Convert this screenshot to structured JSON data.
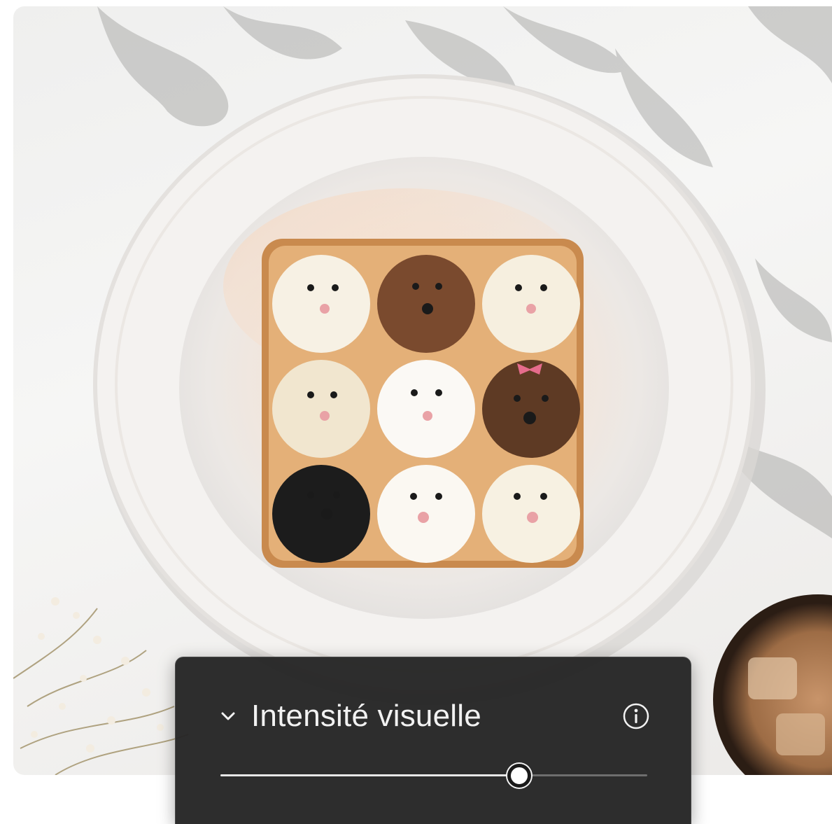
{
  "panel": {
    "title": "Intensité visuelle",
    "collapse_icon": "chevron-down-icon",
    "info_icon": "info-icon",
    "slider_value": 0.7
  },
  "colors": {
    "panel_background": "#262626",
    "slider_fill": "#e8e8e8",
    "slider_track": "#6e6e6e"
  }
}
